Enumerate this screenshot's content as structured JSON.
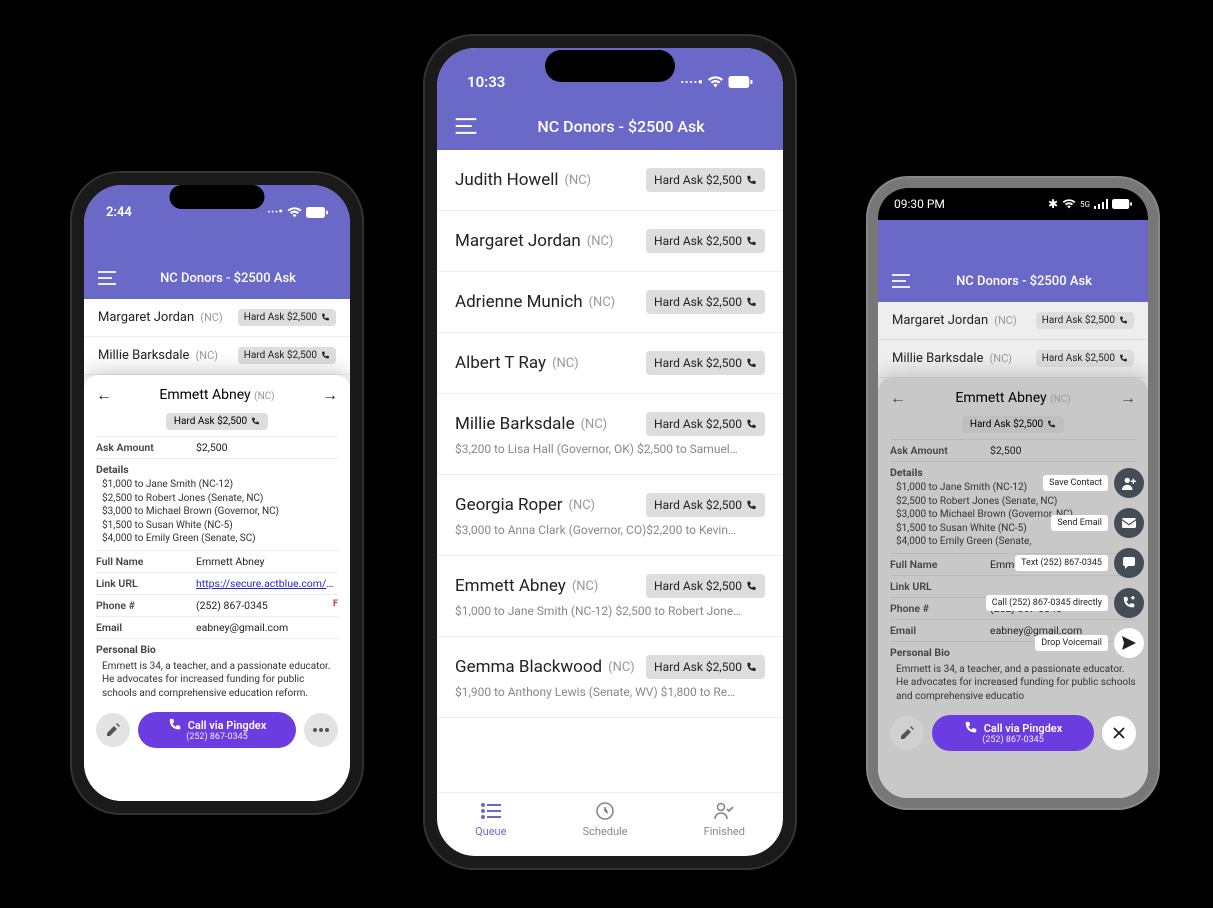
{
  "colors": {
    "brand": "#6b69c8",
    "accent": "#6b3ce0"
  },
  "status": {
    "p1_time": "2:44",
    "p2_time": "10:33",
    "p3_time": "09:30 PM"
  },
  "header_title": "NC Donors - $2500 Ask",
  "ask_pill": "Hard Ask $2,500",
  "queue_center": [
    {
      "name": "Judith Howell",
      "state": "(NC)",
      "sub": ""
    },
    {
      "name": "Margaret Jordan",
      "state": "(NC)",
      "sub": ""
    },
    {
      "name": "Adrienne Munich",
      "state": "(NC)",
      "sub": ""
    },
    {
      "name": "Albert T Ray",
      "state": "(NC)",
      "sub": ""
    },
    {
      "name": "Millie Barksdale",
      "state": "(NC)",
      "sub": "$3,200 to Lisa Hall (Governor, OK) $2,500 to Samuel…"
    },
    {
      "name": "Georgia Roper",
      "state": "(NC)",
      "sub": "$3,000 to Anna Clark (Governor, CO)$2,200 to Kevin…"
    },
    {
      "name": "Emmett Abney",
      "state": "(NC)",
      "sub": "$1,000 to Jane Smith (NC-12) $2,500 to Robert Jone…"
    },
    {
      "name": "Gemma Blackwood",
      "state": "(NC)",
      "sub": "$1,900 to Anthony Lewis (Senate, WV) $1,800 to Re…"
    }
  ],
  "queue_small": [
    {
      "name": "Margaret Jordan",
      "state": "(NC)"
    },
    {
      "name": "Millie Barksdale",
      "state": "(NC)"
    }
  ],
  "tabs": {
    "queue": "Queue",
    "schedule": "Schedule",
    "finished": "Finished"
  },
  "detail": {
    "name": "Emmett Abney",
    "state": "(NC)",
    "ask_label": "Ask Amount",
    "ask_value": "$2,500",
    "details_label": "Details",
    "details_lines": [
      "$1,000 to Jane Smith (NC-12)",
      "$2,500 to Robert Jones (Senate, NC)",
      "$3,000 to Michael Brown (Governor, NC)",
      "$1,500 to Susan White (NC-5)",
      "$4,000 to Emily Green (Senate, SC)"
    ],
    "fullname_label": "Full Name",
    "fullname_value": "Emmett Abney",
    "link_label": "Link URL",
    "link_value": "https://secure.actblue.com/dor",
    "phone_label": "Phone #",
    "phone_value": "(252) 867-0345",
    "phone_flag": "F",
    "email_label": "Email",
    "email_value": "eabney@gmail.com",
    "bio_label": "Personal Bio",
    "bio_value": "Emmett is 34, a teacher, and a passionate educator. He advocates for increased funding for public schools and comprehensive education reform.",
    "call_cta": "Call via Pingdex",
    "call_sub": "(252) 867-0345"
  },
  "detail_p3": {
    "details_last_line": "$4,000 to Emily Green (Senate,",
    "bio_value": "Emmett is 34, a teacher, and a passionate educator. He advocates for increased funding for public schools and comprehensive educatio"
  },
  "fabs": {
    "save": "Save Contact",
    "email": "Send Email",
    "text": "Text (252) 867-0345",
    "call_direct": "Call (252) 867-0345 directly",
    "vm": "Drop Voicemail"
  }
}
